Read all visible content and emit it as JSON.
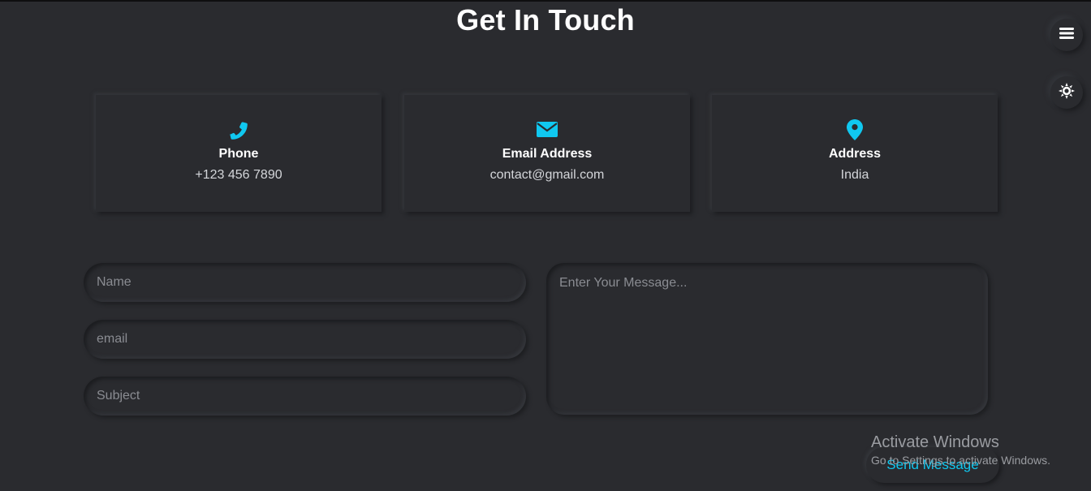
{
  "page": {
    "title": "Get In Touch"
  },
  "side_buttons": [
    {
      "icon": "menu-icon"
    },
    {
      "icon": "theme-toggle-icon"
    }
  ],
  "contact_cards": [
    {
      "icon": "phone-icon",
      "label": "Phone",
      "value": "+123 456 7890"
    },
    {
      "icon": "envelope-icon",
      "label": "Email Address",
      "value": "contact@gmail.com"
    },
    {
      "icon": "map-pin-icon",
      "label": "Address",
      "value": "India"
    }
  ],
  "form": {
    "name_placeholder": "Name",
    "email_placeholder": "email",
    "subject_placeholder": "Subject",
    "message_placeholder": "Enter Your Message...",
    "send_label": "Send Message"
  },
  "watermark": {
    "title": "Activate Windows",
    "subtitle": "Go to Settings to activate Windows."
  },
  "colors": {
    "background": "#2a2b2f",
    "accent": "#10c8f0",
    "text": "#ffffff"
  }
}
